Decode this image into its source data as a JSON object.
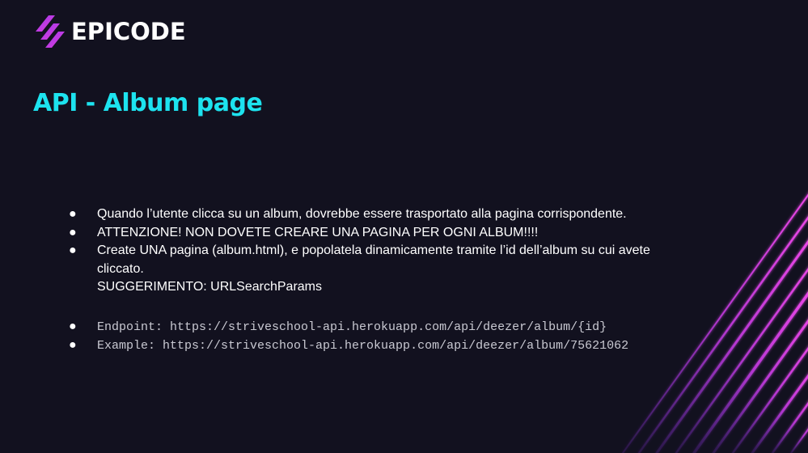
{
  "brand": {
    "name": "EPICODE"
  },
  "slide": {
    "title": "API - Album page",
    "bullets": [
      "Quando l’utente clicca su un album, dovrebbe essere trasportato alla pagina corrispondente.",
      "ATTENZIONE! NON DOVETE CREARE UNA PAGINA PER OGNI ALBUM!!!!",
      "Create UNA pagina (album.html), e popolatela dinamicamente tramite l’id dell’album su cui avete cliccato.",
      "SUGGERIMENTO: URLSearchParams"
    ],
    "code_bullets": [
      "Endpoint: https://striveschool-api.herokuapp.com/api/deezer/album/{id}",
      "Example: https://striveschool-api.herokuapp.com/api/deezer/album/75621062"
    ]
  },
  "colors": {
    "background": "#12111f",
    "title": "#1de3ef",
    "text": "#ffffff",
    "code_text": "#c9c9d2",
    "accent_pink": "#e23bd6",
    "accent_purple": "#7b2fd0"
  },
  "icons": {
    "logo": "epicode-logo-icon",
    "bullet": "bullet-dot"
  }
}
